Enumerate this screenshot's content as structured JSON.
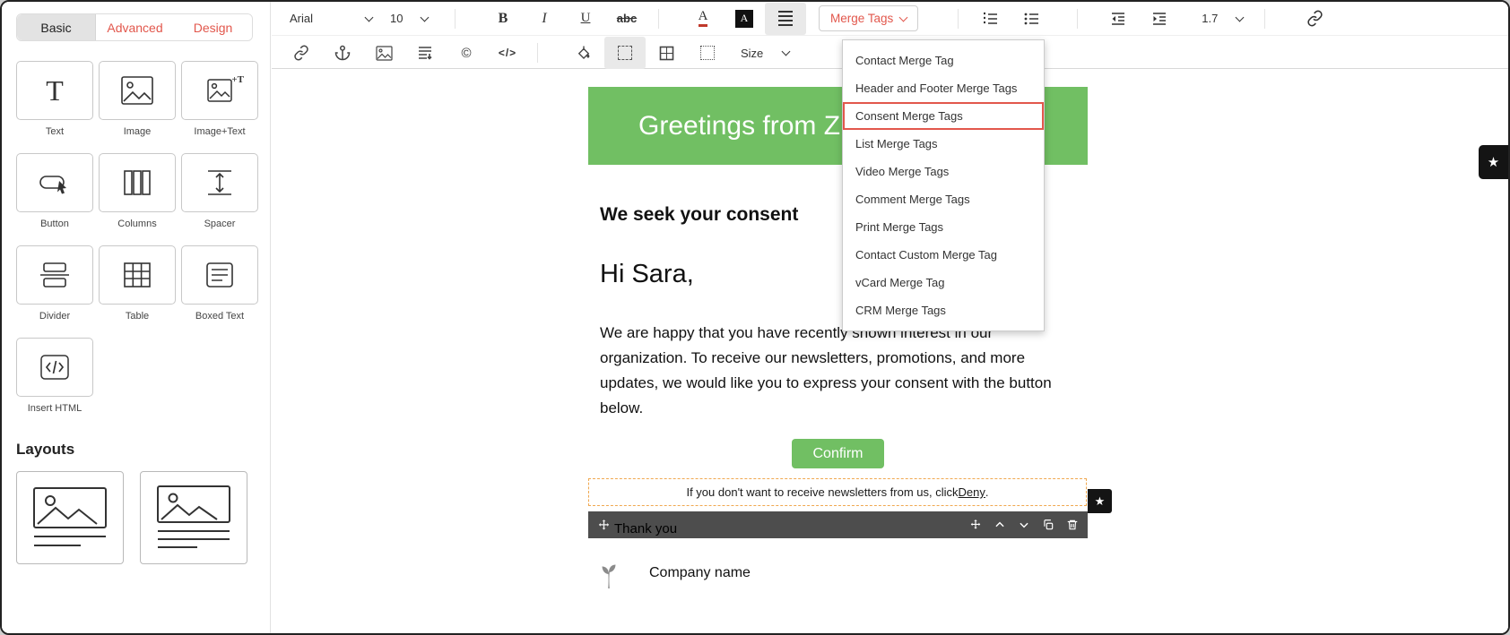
{
  "sidebar": {
    "tabs": [
      "Basic",
      "Advanced",
      "Design"
    ],
    "active_tab": "Basic",
    "components": [
      "Text",
      "Image",
      "Image+Text",
      "Button",
      "Columns",
      "Spacer",
      "Divider",
      "Table",
      "Boxed Text",
      "Insert HTML"
    ],
    "layouts_heading": "Layouts"
  },
  "toolbar": {
    "font_family": "Arial",
    "font_size": "10",
    "bold": "B",
    "italic": "I",
    "underline": "U",
    "strike": "abc",
    "font_color": "A",
    "highlight": "A",
    "merge_tags": "Merge Tags",
    "line_height": "1.7",
    "copyright": "©",
    "size": "Size"
  },
  "merge_menu": {
    "items": [
      "Contact Merge Tag",
      "Header and Footer Merge Tags",
      "Consent Merge Tags",
      "List Merge Tags",
      "Video Merge Tags",
      "Comment Merge Tags",
      "Print Merge Tags",
      "Contact Custom Merge Tag",
      "vCard Merge Tag",
      "CRM Merge Tags"
    ],
    "highlighted": "Consent Merge Tags"
  },
  "email": {
    "banner_text": "Greetings from Z",
    "heading": "We seek your consent",
    "salutation": "Hi Sara,",
    "body": "We are happy that you have recently shown interest in our organization. To receive our newsletters, promotions, and more updates, we would like you to express your consent with the button below.",
    "confirm_button": "Confirm",
    "deny_prefix": "If you don't want to receive newsletters from us, click ",
    "deny_link": "Deny",
    "deny_suffix": ".",
    "company_name": "Company name"
  },
  "block_toolbar": {
    "label": "Thank you"
  },
  "icons": {
    "star": "★",
    "text_glyph": "T",
    "image_text_glyph": "+T",
    "code_glyph": "</>"
  },
  "colors": {
    "banner_green": "#71bf63",
    "accent_red": "#e2574c",
    "consent_highlight": "#e2574c",
    "deny_border": "#f0a850",
    "block_bar": "#3e3e3e"
  }
}
